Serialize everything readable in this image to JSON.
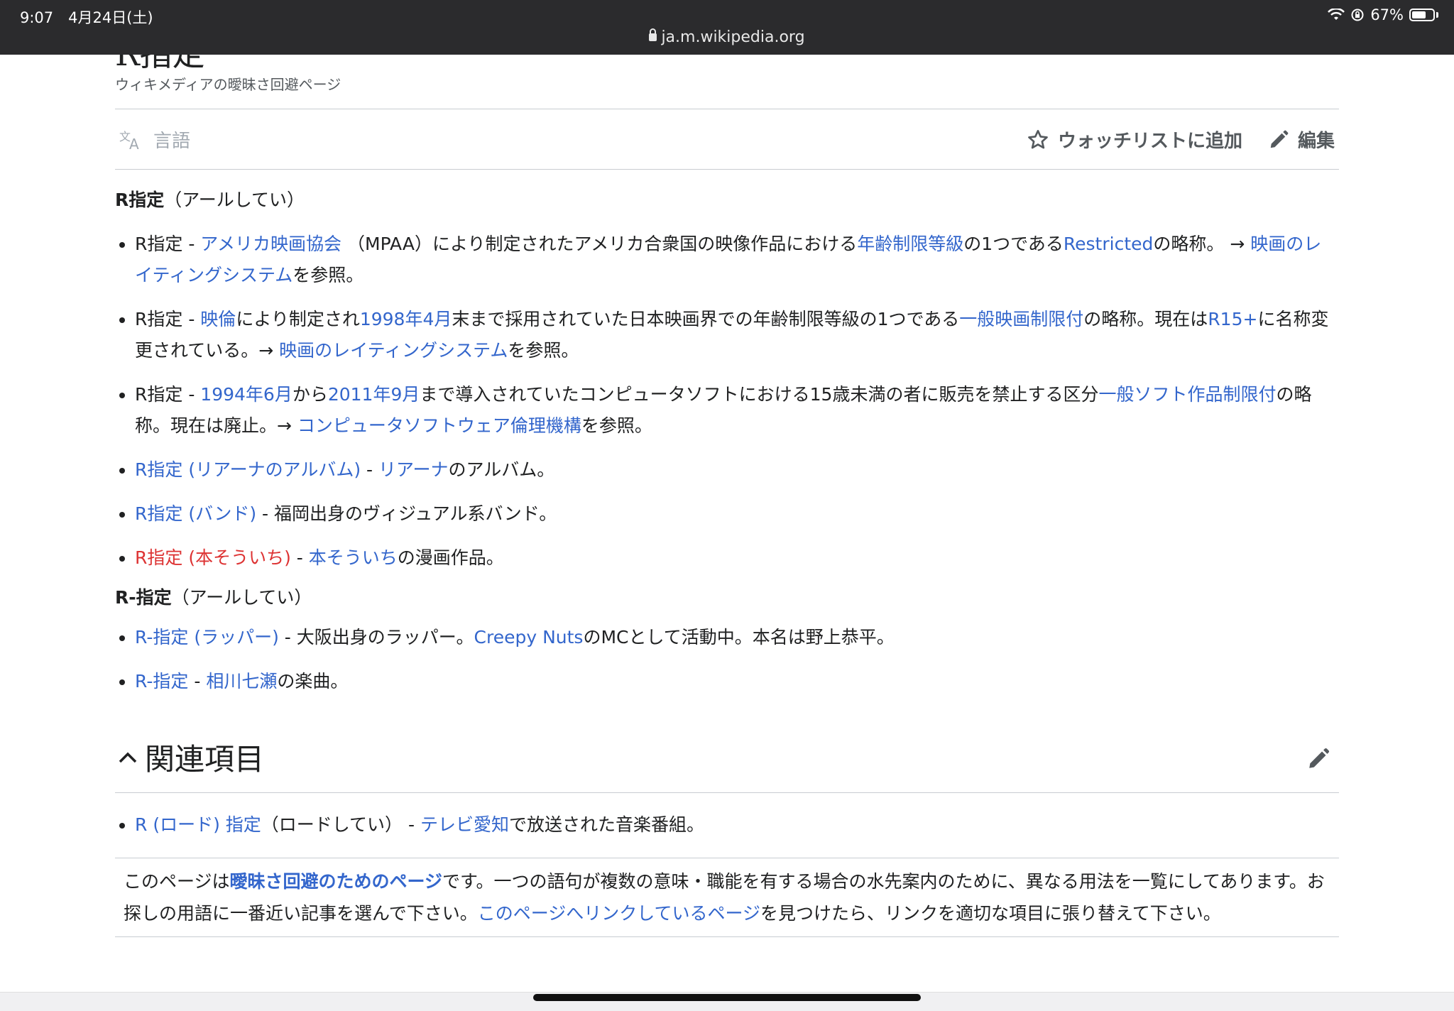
{
  "status": {
    "time_date": "9:07　4月24日(土)",
    "battery": "67%",
    "battery_level": 0.67
  },
  "browser": {
    "url": "ja.m.wikipedia.org"
  },
  "page": {
    "title": "R指定",
    "subtitle": "ウィキメディアの曖昧さ回避ページ"
  },
  "toolbar": {
    "language": "言語",
    "watchlist": "ウォッチリストに追加",
    "edit": "編集"
  },
  "section_r": {
    "head_term": "R指定",
    "head_reading": "（アールしてい）",
    "items": [
      {
        "t1": "R指定 - ",
        "l1": "アメリカ映画協会",
        "t2": " （MPAA）により制定されたアメリカ合衆国の映像作品における",
        "l2": "年齢制限等級",
        "t3": "の1つである",
        "l3": "Restricted",
        "t4": "の略称。 → ",
        "l4": "映画のレイティングシステム",
        "t5": "を参照。"
      },
      {
        "t1": "R指定 - ",
        "l1": "映倫",
        "t2": "により制定され",
        "l2": "1998年4月",
        "t3": "末まで採用されていた日本映画界での年齢制限等級の1つである",
        "l3": "一般映画制限付",
        "t4": "の略称。現在は",
        "l4": "R15+",
        "t5": "に名称変更されている。→ ",
        "l5": "映画のレイティングシステム",
        "t6": "を参照。"
      },
      {
        "t1": "R指定 - ",
        "l1": "1994年6月",
        "t2": "から",
        "l2": "2011年9月",
        "t3": "まで導入されていたコンピュータソフトにおける15歳未満の者に販売を禁止する区分",
        "l3": "一般ソフト作品制限付",
        "t4": "の略称。現在は廃止。→ ",
        "l4": "コンピュータソフトウェア倫理機構",
        "t5": "を参照。"
      },
      {
        "l1": "R指定 (リアーナのアルバム)",
        "t1": " - ",
        "l2": "リアーナ",
        "t2": "のアルバム。"
      },
      {
        "l1": "R指定 (バンド)",
        "t1": " - 福岡出身のヴィジュアル系バンド。"
      },
      {
        "r1": "R指定 (本そういち)",
        "t1": " - ",
        "l2": "本そういち",
        "t2": "の漫画作品。"
      }
    ]
  },
  "section_rdash": {
    "head_term": "R-指定",
    "head_reading": "（アールしてい）",
    "items": [
      {
        "l1": "R-指定 (ラッパー)",
        "t1": " - 大阪出身のラッパー。",
        "l2": "Creepy Nuts",
        "t2": "のMCとして活動中。本名は野上恭平。"
      },
      {
        "l1": "R-指定",
        "t1": " - ",
        "l2": "相川七瀬",
        "t2": "の楽曲。"
      }
    ]
  },
  "related": {
    "title": "関連項目",
    "item": {
      "l1": "R (ロード) 指定",
      "t1": "（ロードしてい） - ",
      "l2": "テレビ愛知",
      "t2": "で放送された音楽番組。"
    }
  },
  "dab_notice": {
    "t1": "このページは",
    "l1": "曖昧さ回避のためのページ",
    "t2": "です。一つの語句が複数の意味・職能を有する場合の水先案内のために、異なる用法を一覧にしてあります。お探しの用語に一番近い記事を選んで下さい。",
    "l2": "このページへリンクしているページ",
    "t3": "を見つけたら、リンクを適切な項目に張り替えて下さい。"
  }
}
